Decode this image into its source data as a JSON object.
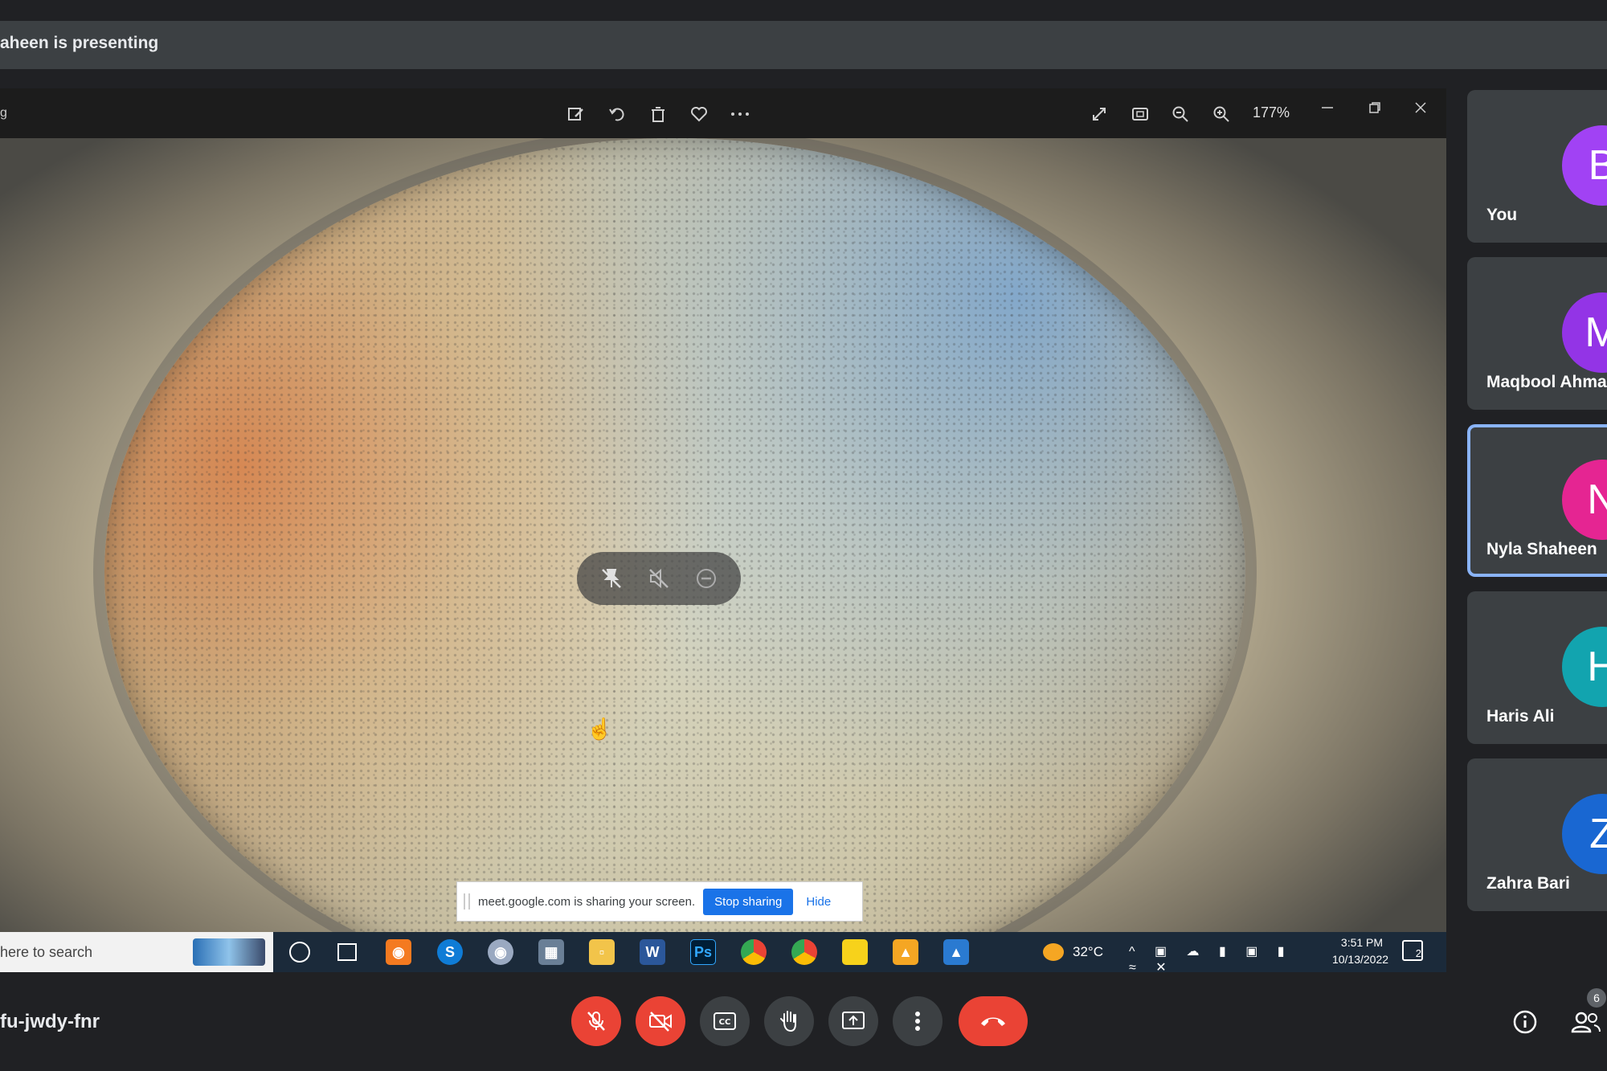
{
  "presenting": {
    "text": "aheen is presenting"
  },
  "viewer": {
    "file_fragment": "g",
    "zoom_level": "177%",
    "toolbar_icons": [
      "edit-icon",
      "rotate-icon",
      "delete-icon",
      "favorite-icon",
      "more-icon"
    ],
    "right_icons": [
      "fullscreen-icon",
      "fit-window-icon",
      "zoom-out-icon",
      "zoom-in-icon",
      "minimize-icon",
      "restore-icon",
      "close-icon"
    ]
  },
  "share_banner": {
    "text": "meet.google.com is sharing your screen.",
    "stop_label": "Stop sharing",
    "hide_label": "Hide"
  },
  "win_taskbar": {
    "search_text": "here to search",
    "temperature": "32°C",
    "time": "3:51 PM",
    "date": "10/13/2022",
    "notification_count": "2"
  },
  "participants": [
    {
      "initial": "B",
      "name": "You",
      "color": "#a142f4",
      "active": false
    },
    {
      "initial": "M",
      "name": "Maqbool Ahma",
      "color": "#9334e6",
      "active": false
    },
    {
      "initial": "N",
      "name": "Nyla Shaheen",
      "color": "#e52592",
      "active": true
    },
    {
      "initial": "H",
      "name": "Haris Ali",
      "color": "#12a4af",
      "active": false
    },
    {
      "initial": "Z",
      "name": "Zahra Bari",
      "color": "#1967d2",
      "active": false
    }
  ],
  "bottom_bar": {
    "meeting_code": "fu-jwdy-fnr",
    "people_count": "6"
  },
  "colors": {
    "accent": "#1a73e8",
    "danger": "#ea4335",
    "bar": "#3c4043"
  }
}
